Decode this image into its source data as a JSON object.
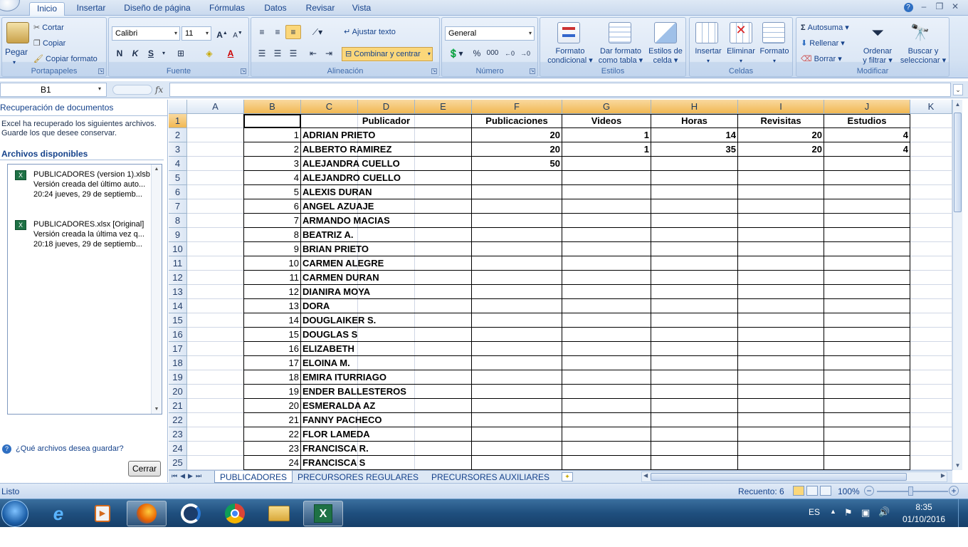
{
  "ribbon": {
    "tabs": [
      "Inicio",
      "Insertar",
      "Diseño de página",
      "Fórmulas",
      "Datos",
      "Revisar",
      "Vista"
    ],
    "clipboard": {
      "paste": "Pegar",
      "cut": "Cortar",
      "copy": "Copiar",
      "format_painter": "Copiar formato",
      "title": "Portapapeles"
    },
    "font": {
      "name": "Calibri",
      "size": "11",
      "bold": "N",
      "italic": "K",
      "underline": "S",
      "title": "Fuente"
    },
    "alignment": {
      "wrap": "Ajustar texto",
      "merge": "Combinar y centrar",
      "title": "Alineación"
    },
    "number": {
      "format": "General",
      "percent": "%",
      "thousands": "000",
      "title": "Número"
    },
    "styles": {
      "conditional": [
        "Formato",
        "condicional"
      ],
      "table": [
        "Dar formato",
        "como tabla"
      ],
      "cell": [
        "Estilos de",
        "celda"
      ],
      "title": "Estilos"
    },
    "cells": {
      "insert": "Insertar",
      "delete": "Eliminar",
      "format": "Formato",
      "title": "Celdas"
    },
    "editing": {
      "autosum": "Autosuma",
      "fill": "Rellenar",
      "clear": "Borrar",
      "sort": [
        "Ordenar",
        "y filtrar"
      ],
      "find": [
        "Buscar y",
        "seleccionar"
      ],
      "title": "Modificar"
    }
  },
  "formula_bar": {
    "name_box": "B1",
    "fx": "fx"
  },
  "recovery": {
    "title": "Recuperación de documentos",
    "intro1": "Excel ha recuperado los siguientes archivos.",
    "intro2": "Guarde los que desee conservar.",
    "available": "Archivos disponibles",
    "files": [
      {
        "name": "PUBLICADORES (version 1).xlsb",
        "desc": "Versión creada del último auto...",
        "time": "20:24 jueves, 29 de septiemb..."
      },
      {
        "name": "PUBLICADORES.xlsx  [Original]",
        "desc": "Versión creada la última vez q...",
        "time": "20:18 jueves, 29 de septiemb..."
      }
    ],
    "help": "¿Qué archivos desea guardar?",
    "close": "Cerrar"
  },
  "sheet": {
    "columns": [
      "A",
      "B",
      "C",
      "D",
      "E",
      "F",
      "G",
      "H",
      "I",
      "J",
      "K"
    ],
    "headers": {
      "publicador": "Publicador",
      "publicaciones": "Publicaciones",
      "videos": "Videos",
      "horas": "Horas",
      "revisitas": "Revisitas",
      "estudios": "Estudios"
    },
    "rows": [
      {
        "n": "1",
        "name": "ADRIAN PRIETO",
        "f": "20",
        "g": "1",
        "h": "14",
        "i": "20",
        "j": "4"
      },
      {
        "n": "2",
        "name": "ALBERTO RAMIREZ",
        "f": "20",
        "g": "1",
        "h": "35",
        "i": "20",
        "j": "4"
      },
      {
        "n": "3",
        "name": "ALEJANDRA CUELLO",
        "f": "50",
        "g": "",
        "h": "",
        "i": "",
        "j": ""
      },
      {
        "n": "4",
        "name": "ALEJANDRO CUELLO",
        "f": "",
        "g": "",
        "h": "",
        "i": "",
        "j": ""
      },
      {
        "n": "5",
        "name": "ALEXIS DURAN",
        "f": "",
        "g": "",
        "h": "",
        "i": "",
        "j": ""
      },
      {
        "n": "6",
        "name": "ANGEL AZUAJE",
        "f": "",
        "g": "",
        "h": "",
        "i": "",
        "j": ""
      },
      {
        "n": "7",
        "name": "ARMANDO MACIAS",
        "f": "",
        "g": "",
        "h": "",
        "i": "",
        "j": ""
      },
      {
        "n": "8",
        "name": "BEATRIZ A.",
        "f": "",
        "g": "",
        "h": "",
        "i": "",
        "j": ""
      },
      {
        "n": "9",
        "name": "BRIAN PRIETO",
        "f": "",
        "g": "",
        "h": "",
        "i": "",
        "j": ""
      },
      {
        "n": "10",
        "name": "CARMEN ALEGRE",
        "f": "",
        "g": "",
        "h": "",
        "i": "",
        "j": ""
      },
      {
        "n": "11",
        "name": "CARMEN DURAN",
        "f": "",
        "g": "",
        "h": "",
        "i": "",
        "j": ""
      },
      {
        "n": "12",
        "name": "DIANIRA MOYA",
        "f": "",
        "g": "",
        "h": "",
        "i": "",
        "j": ""
      },
      {
        "n": "13",
        "name": "DORA",
        "f": "",
        "g": "",
        "h": "",
        "i": "",
        "j": ""
      },
      {
        "n": "14",
        "name": "DOUGLAIKER S.",
        "f": "",
        "g": "",
        "h": "",
        "i": "",
        "j": ""
      },
      {
        "n": "15",
        "name": "DOUGLAS S",
        "f": "",
        "g": "",
        "h": "",
        "i": "",
        "j": ""
      },
      {
        "n": "16",
        "name": "ELIZABETH",
        "f": "",
        "g": "",
        "h": "",
        "i": "",
        "j": ""
      },
      {
        "n": "17",
        "name": "ELOINA M.",
        "f": "",
        "g": "",
        "h": "",
        "i": "",
        "j": ""
      },
      {
        "n": "18",
        "name": "EMIRA ITURRIAGO",
        "f": "",
        "g": "",
        "h": "",
        "i": "",
        "j": ""
      },
      {
        "n": "19",
        "name": "ENDER BALLESTEROS",
        "f": "",
        "g": "",
        "h": "",
        "i": "",
        "j": ""
      },
      {
        "n": "20",
        "name": "ESMERALDA AZ",
        "f": "",
        "g": "",
        "h": "",
        "i": "",
        "j": ""
      },
      {
        "n": "21",
        "name": "FANNY PACHECO",
        "f": "",
        "g": "",
        "h": "",
        "i": "",
        "j": ""
      },
      {
        "n": "22",
        "name": "FLOR LAMEDA",
        "f": "",
        "g": "",
        "h": "",
        "i": "",
        "j": ""
      },
      {
        "n": "23",
        "name": "FRANCISCA R.",
        "f": "",
        "g": "",
        "h": "",
        "i": "",
        "j": ""
      },
      {
        "n": "24",
        "name": "FRANCISCA S",
        "f": "",
        "g": "",
        "h": "",
        "i": "",
        "j": ""
      }
    ],
    "tabs": [
      "PUBLICADORES",
      "PRECURSORES REGULARES",
      "PRECURSORES AUXILIARES"
    ]
  },
  "status": {
    "ready": "Listo",
    "count": "Recuento: 6",
    "zoom": "100%"
  },
  "taskbar": {
    "lang": "ES",
    "time": "8:35",
    "date": "01/10/2016"
  },
  "colors": {
    "accent": "#15428b",
    "selected_header": "#f1b853",
    "excel_green": "#1e7145"
  }
}
